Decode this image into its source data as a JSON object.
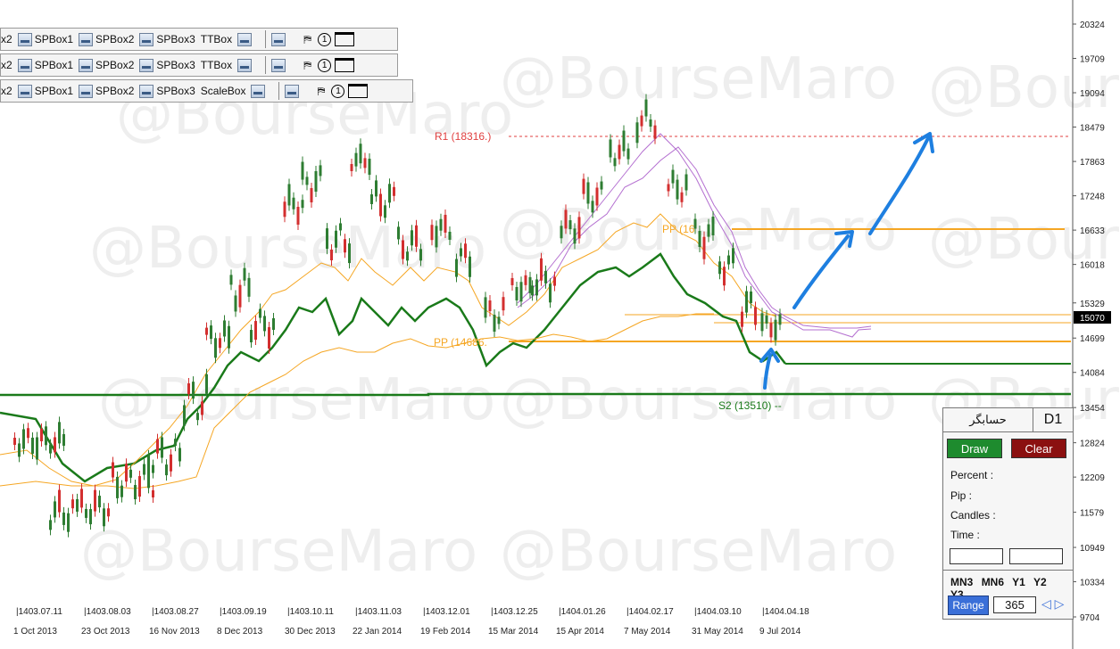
{
  "watermark": "@BourseMaro",
  "toolbars": [
    {
      "items": [
        "x2",
        "SPBox1",
        "SPBox2",
        "SPBox3",
        "TTBox"
      ]
    },
    {
      "items": [
        "x2",
        "SPBox1",
        "SPBox2",
        "SPBox3",
        "TTBox"
      ]
    },
    {
      "items": [
        "x2",
        "SPBox1",
        "SPBox2",
        "SPBox3",
        "ScaleBox"
      ]
    }
  ],
  "toolbar_icons": [
    "window-icon",
    "flag-icon",
    "number-one-icon",
    "window-blank-icon"
  ],
  "toolbar_circle_text": "1",
  "pivot_labels": {
    "r1": "R1 (18316.)",
    "pp_upper": "PP (16",
    "pp_lower": "PP (14686.",
    "s2": "S2 (13510) --"
  },
  "current_price": "15070",
  "panel": {
    "name": "حسابگر",
    "timeframe": "D1",
    "draw": "Draw",
    "clear": "Clear",
    "labels": [
      "Percent :",
      "Pip :",
      "Candles :",
      "Time :"
    ],
    "timeframes": [
      "MN3",
      "MN6",
      "Y1",
      "Y2",
      "Y3"
    ],
    "range_label": "Range",
    "range_value": "365",
    "prev_arrow": "◁",
    "next_arrow": "▷"
  },
  "colors": {
    "bull": "#2e7d32",
    "bear": "#d32f2f",
    "pivot": "#f5a623",
    "support": "#1a7a1a",
    "resistance": "#e04040",
    "ichimoku": "#b46fd0",
    "arrow": "#1e7fe0"
  },
  "chart_data": {
    "type": "candlestick",
    "y_ticks": [
      "20324",
      "19709",
      "19094",
      "18479",
      "17863",
      "17248",
      "16633",
      "16018",
      "15329",
      "14699",
      "14084",
      "13454",
      "12824",
      "12209",
      "11579",
      "10949",
      "10334",
      "9704"
    ],
    "y_range": [
      9704,
      20324
    ],
    "x_ticks_top": [
      "|1403.07.11",
      "|1403.08.03",
      "|1403.08.27",
      "|1403.09.19",
      "|1403.10.11",
      "|1403.11.03",
      "|1403.12.01",
      "|1403.12.25",
      "|1404.01.26",
      "|1404.02.17",
      "|1404.03.10",
      "|1404.04.18"
    ],
    "x_ticks_bottom": [
      "1 Oct 2013",
      "23 Oct 2013",
      "16 Nov 2013",
      "8 Dec 2013",
      "30 Dec 2013",
      "22 Jan 2014",
      "19 Feb 2014",
      "15 Mar 2014",
      "15 Apr 2014",
      "7 May 2014",
      "31 May 2014",
      "9 Jul 2014"
    ],
    "levels": [
      {
        "name": "R1",
        "value": 18316
      },
      {
        "name": "PP",
        "value": 16700
      },
      {
        "name": "PP",
        "value": 14686
      },
      {
        "name": "S2",
        "value": 13510
      }
    ]
  }
}
